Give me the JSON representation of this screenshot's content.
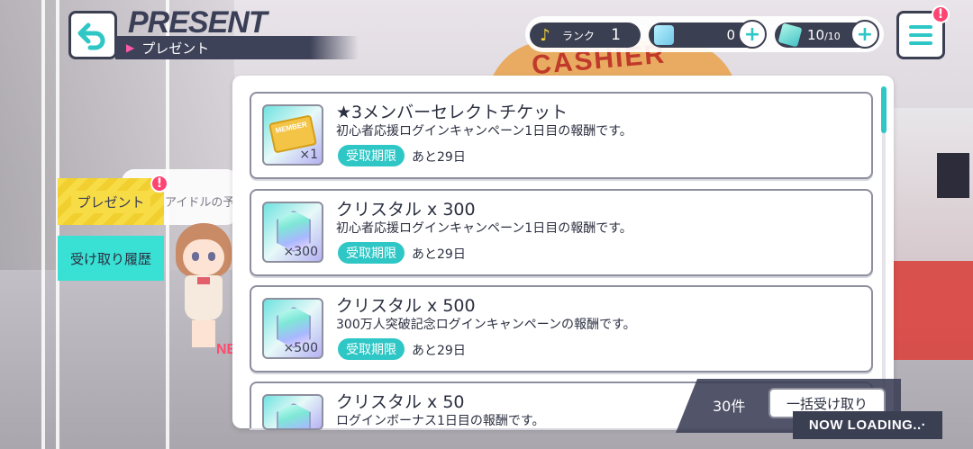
{
  "header": {
    "title": "PRESENT",
    "subtitle": "プレゼント"
  },
  "status": {
    "rank_label": "ランク",
    "rank_value": "1",
    "crystal_value": "0",
    "stamina_value": "10",
    "stamina_max": "/10"
  },
  "background": {
    "cashier_sign": "CASHIER"
  },
  "menu_alert": "!",
  "tabs": {
    "present": "プレゼント",
    "history": "受け取り履歴",
    "present_alert": "!"
  },
  "speech_text": "アイドルの予",
  "character_badge": "NE",
  "items": [
    {
      "icon": "member-ticket-icon",
      "title": "★3メンバーセレクトチケット",
      "description": "初心者応援ログインキャンペーン1日目の報酬です。",
      "quantity": "×1",
      "limit_label": "受取期限",
      "limit_text": "あと29日",
      "ticket_text": "MEMBER"
    },
    {
      "icon": "crystal-icon",
      "title": "クリスタル x 300",
      "description": "初心者応援ログインキャンペーン1日目の報酬です。",
      "quantity": "×300",
      "limit_label": "受取期限",
      "limit_text": "あと29日"
    },
    {
      "icon": "crystal-icon",
      "title": "クリスタル x 500",
      "description": "300万人突破記念ログインキャンペーンの報酬です。",
      "quantity": "×500",
      "limit_label": "受取期限",
      "limit_text": "あと29日"
    },
    {
      "icon": "crystal-icon",
      "title": "クリスタル x 50",
      "description": "ログインボーナス1日目の報酬です。"
    }
  ],
  "footer": {
    "count": "30件",
    "receive_all": "一括受け取り",
    "loading": "NOW LOADING..·"
  },
  "colors": {
    "accent": "#2fc7c5",
    "dark": "#3b3f52",
    "present_tab": "#f7dc46",
    "history_tab": "#39e0d4",
    "alert": "#ff4472"
  }
}
